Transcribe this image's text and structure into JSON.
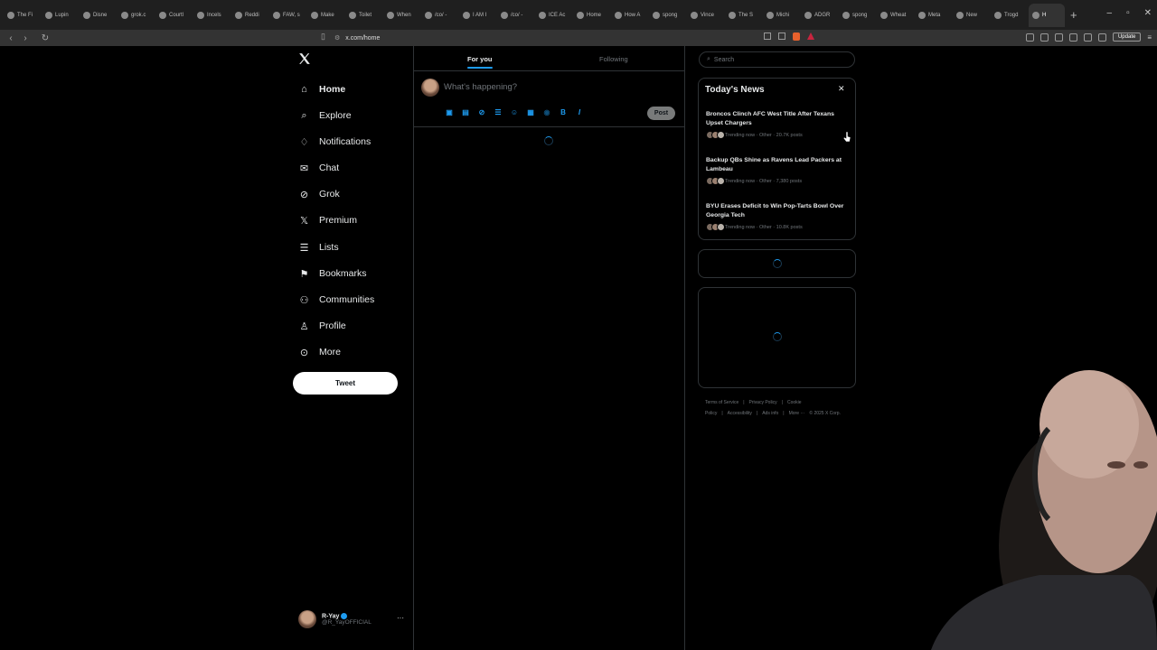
{
  "browser": {
    "tabs": [
      "The Fi",
      "Lupin",
      "Disne",
      "grok.c",
      "Courtl",
      "Incels",
      "Reddi",
      "FAW, s",
      "Make",
      "Toilet",
      "When",
      "/co/ -",
      "I AM I",
      "/co/ -",
      "ICE Ac",
      "Home",
      "How A",
      "spong",
      "Vince",
      "The S",
      "Michi",
      "ADGR",
      "spong",
      "Wheat",
      "Meta",
      "New",
      "Trogd",
      "H"
    ],
    "url": "x.com/home",
    "update_label": "Update"
  },
  "nav": {
    "items": [
      {
        "label": "Home",
        "icon": "home-icon"
      },
      {
        "label": "Explore",
        "icon": "search-icon"
      },
      {
        "label": "Notifications",
        "icon": "bell-icon"
      },
      {
        "label": "Chat",
        "icon": "mail-icon"
      },
      {
        "label": "Grok",
        "icon": "grok-icon"
      },
      {
        "label": "Premium",
        "icon": "x-logo-icon"
      },
      {
        "label": "Lists",
        "icon": "list-icon"
      },
      {
        "label": "Bookmarks",
        "icon": "bookmark-icon"
      },
      {
        "label": "Communities",
        "icon": "people-icon"
      },
      {
        "label": "Profile",
        "icon": "person-icon"
      },
      {
        "label": "More",
        "icon": "more-circle-icon"
      }
    ],
    "tweet_label": "Tweet"
  },
  "user": {
    "name": "R-Yay",
    "handle": "@R_YayOFFICIAL",
    "more": "···"
  },
  "feed": {
    "tab_for_you": "For you",
    "tab_following": "Following",
    "compose_placeholder": "What's happening?",
    "post_label": "Post"
  },
  "search": {
    "placeholder": "Search"
  },
  "news": {
    "title": "Today's News",
    "close": "✕",
    "items": [
      {
        "headline": "Broncos Clinch AFC West Title After Texans Upset Chargers",
        "meta": "Trending now · Other · 20.7K posts"
      },
      {
        "headline": "Backup QBs Shine as Ravens Lead Packers at Lambeau",
        "meta": "Trending now · Other · 7,380 posts"
      },
      {
        "headline": "BYU Erases Deficit to Win Pop-Tarts Bowl Over Georgia Tech",
        "meta": "Trending now · Other · 10.8K posts"
      }
    ]
  },
  "footer": {
    "links": [
      "Terms of Service",
      "|",
      "Privacy Policy",
      "|",
      "Cookie Policy",
      "|",
      "Accessibility",
      "|",
      "Ads info",
      "|",
      "More ···",
      "© 2025 X Corp."
    ]
  },
  "colors": {
    "accent": "#1d9bf0",
    "background": "#000000",
    "border": "#2f3336",
    "muted_text": "#71767b"
  }
}
